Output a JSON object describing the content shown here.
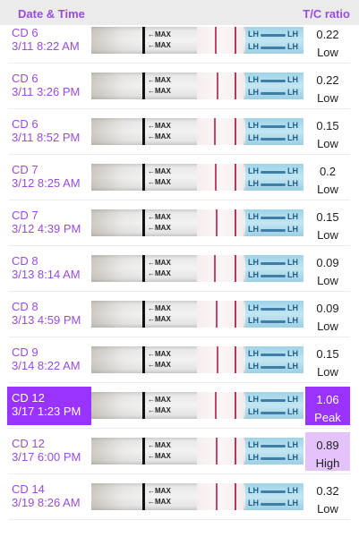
{
  "header": {
    "date_time_label": "Date & Time",
    "ratio_label": "T/C ratio"
  },
  "strip_marks": {
    "max_label": "←MAX",
    "lh_label": "LH"
  },
  "colors": {
    "accent": "#9a4cde",
    "peak_bg": "#9a33ff",
    "high_bg": "#e4c2fb"
  },
  "rows": [
    {
      "cd": "CD 6",
      "time": "3/11 8:22 AM",
      "ratio": "0.22",
      "level": "Low"
    },
    {
      "cd": "CD 6",
      "time": "3/11 3:26 PM",
      "ratio": "0.22",
      "level": "Low"
    },
    {
      "cd": "CD 6",
      "time": "3/11 8:52 PM",
      "ratio": "0.15",
      "level": "Low"
    },
    {
      "cd": "CD 7",
      "time": "3/12 8:25 AM",
      "ratio": "0.2",
      "level": "Low"
    },
    {
      "cd": "CD 7",
      "time": "3/12 4:39 PM",
      "ratio": "0.15",
      "level": "Low"
    },
    {
      "cd": "CD 8",
      "time": "3/13 8:14 AM",
      "ratio": "0.09",
      "level": "Low"
    },
    {
      "cd": "CD 8",
      "time": "3/13 4:59 PM",
      "ratio": "0.09",
      "level": "Low"
    },
    {
      "cd": "CD 9",
      "time": "3/14 8:22 AM",
      "ratio": "0.15",
      "level": "Low"
    },
    {
      "cd": "CD 12",
      "time": "3/17 1:23 PM",
      "ratio": "1.06",
      "level": "Peak",
      "selected": true
    },
    {
      "cd": "CD 12",
      "time": "3/17 6:00 PM",
      "ratio": "0.89",
      "level": "High"
    },
    {
      "cd": "CD 14",
      "time": "3/19 8:26 AM",
      "ratio": "0.32",
      "level": "Low"
    }
  ]
}
